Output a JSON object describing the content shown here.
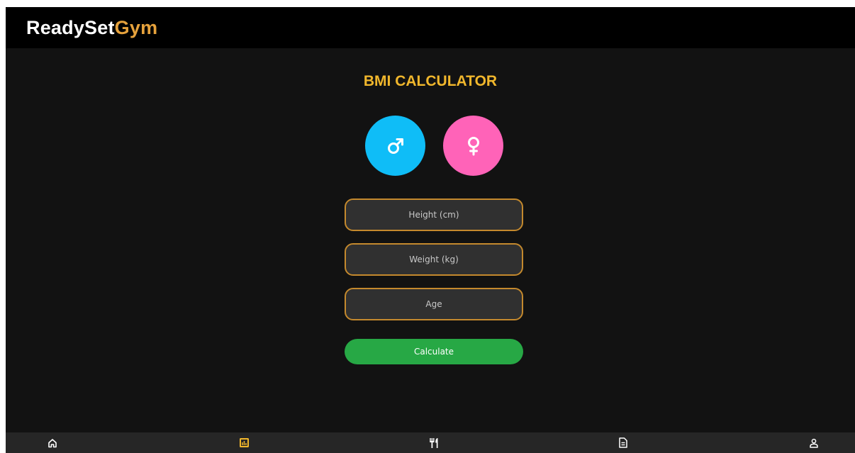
{
  "header": {
    "brand_primary": "ReadySet",
    "brand_accent": "Gym"
  },
  "main": {
    "title": "BMI CALCULATOR",
    "gender_options": [
      {
        "label": "male",
        "icon": "male-symbol-icon",
        "color": "#0fbdf7"
      },
      {
        "label": "female",
        "icon": "female-symbol-icon",
        "color": "#ff63b8"
      }
    ],
    "fields": {
      "height": {
        "value": "",
        "placeholder": "Height (cm)"
      },
      "weight": {
        "value": "",
        "placeholder": "Weight (kg)"
      },
      "age": {
        "value": "",
        "placeholder": "Age"
      }
    },
    "calculate_label": "Calculate"
  },
  "bottom_nav": {
    "items": [
      {
        "icon": "home-icon",
        "active": false
      },
      {
        "icon": "chart-icon",
        "active": true
      },
      {
        "icon": "fork-knife-icon",
        "active": false
      },
      {
        "icon": "document-icon",
        "active": false
      },
      {
        "icon": "user-icon",
        "active": false
      }
    ],
    "active_color": "#f1b72c"
  },
  "colors": {
    "background": "#121212",
    "header": "#000000",
    "accent": "#e6a23c",
    "title": "#f1b72c",
    "field_border": "#c4892d",
    "calculate": "#27a845"
  }
}
